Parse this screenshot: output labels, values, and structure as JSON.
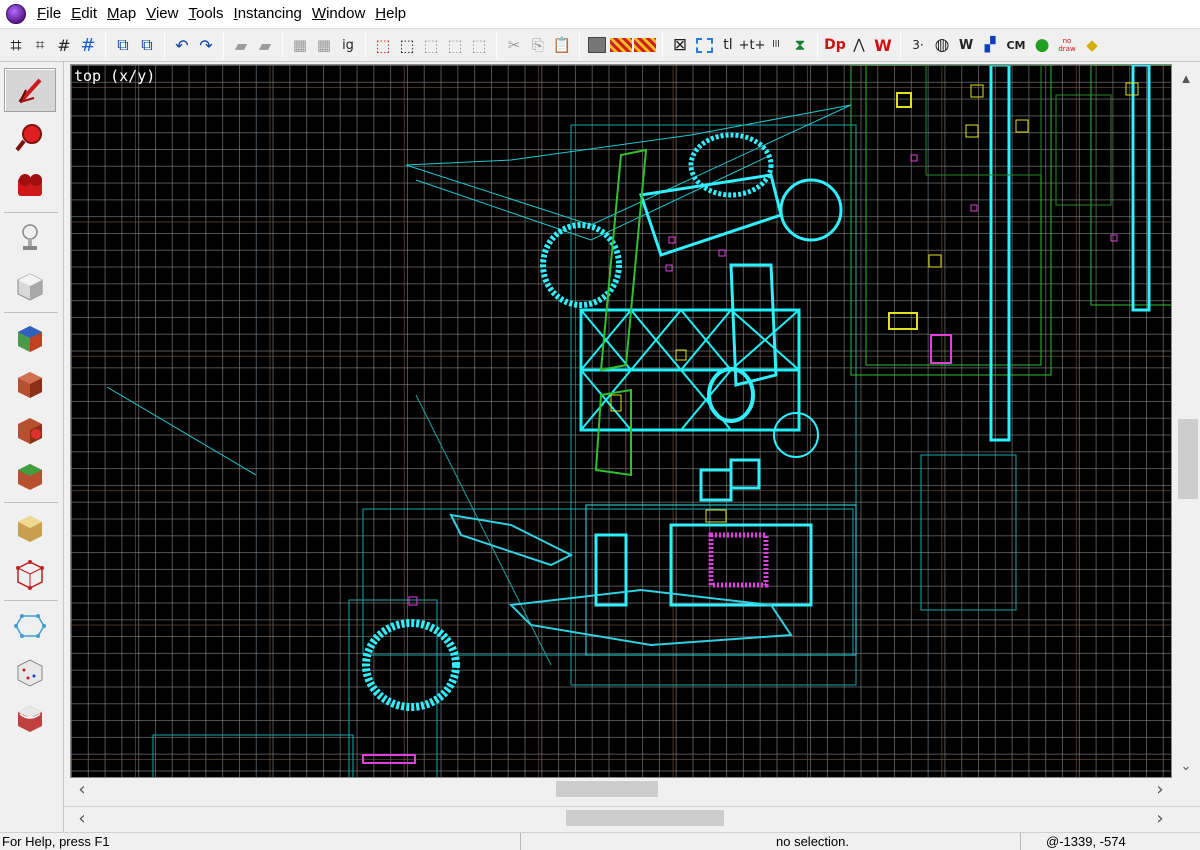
{
  "menu": {
    "items": [
      {
        "accel": "F",
        "rest": "ile"
      },
      {
        "accel": "E",
        "rest": "dit"
      },
      {
        "accel": "M",
        "rest": "ap"
      },
      {
        "accel": "V",
        "rest": "iew"
      },
      {
        "accel": "T",
        "rest": "ools"
      },
      {
        "accel": "I",
        "rest": "nstancing"
      },
      {
        "accel": "W",
        "rest": "indow"
      },
      {
        "accel": "H",
        "rest": "elp"
      }
    ]
  },
  "toolbar": {
    "grid_label": "#",
    "text_ig": "ig",
    "text_tl": "tl",
    "text_cm": "CM",
    "text_nodraw": "no draw"
  },
  "viewport": {
    "label": "top (x/y)"
  },
  "status": {
    "help": "For Help, press F1",
    "selection": "no selection.",
    "coords": "@-1339, -574"
  },
  "colors": {
    "brush_wire": "#20e8f0",
    "entity_pink": "#e040e0",
    "yellow": "#e0e020",
    "green_wire": "#30c030",
    "grid_minor": "#969696",
    "grid_major": "#78583c"
  },
  "icons": {
    "palette": [
      "selection-pointer-icon",
      "magnify-icon",
      "camera-icon",
      "entity-icon",
      "block-brush-icon",
      "texture-apply-icon",
      "apply-current-texture-icon",
      "decal-icon",
      "overlay-icon",
      "clipping-icon",
      "vertex-tool-icon",
      "path-tool-icon",
      "sound-icon",
      "sprinkle-icon"
    ]
  }
}
